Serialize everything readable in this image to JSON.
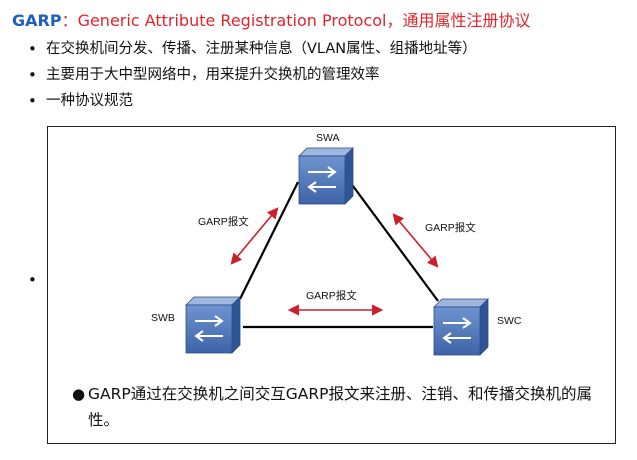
{
  "title": {
    "acronym": "GARP",
    "rest": "：Generic Attribute Registration Protocol，通用属性注册协议"
  },
  "bullets": [
    "在交换机间分发、传播、注册某种信息（VLAN属性、组播地址等）",
    "主要用于大中型网络中，用来提升交换机的管理效率",
    "一种协议规范"
  ],
  "diagram": {
    "switches": {
      "top": "SWA",
      "left": "SWB",
      "right": "SWC"
    },
    "message_labels": {
      "left": "GARP报文",
      "right": "GARP报文",
      "bottom": "GARP报文"
    },
    "colors": {
      "switch": "#4a74b5",
      "link": "#000000",
      "arrow": "#cc1f2a"
    },
    "icons": [
      "switch-icon",
      "double-arrow-icon"
    ]
  },
  "note": "GARP通过在交换机之间交互GARP报文来注册、注销、和传播交换机的属性。"
}
